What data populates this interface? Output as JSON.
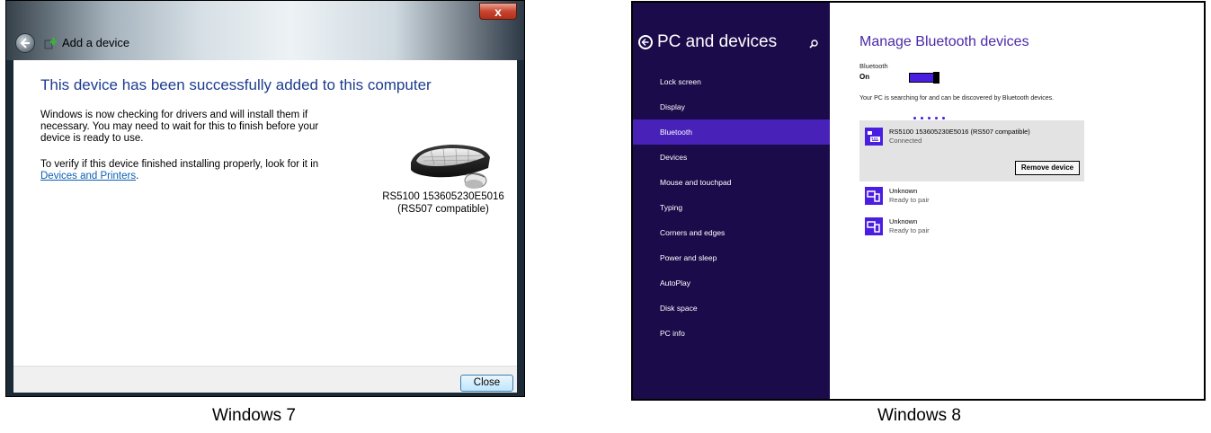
{
  "win7": {
    "close_glyph": "x",
    "wizard_title": "Add a device",
    "heading": "This device has been successfully added to this computer",
    "paragraph1": "Windows is now checking for drivers and will install them if necessary. You may need to wait for this to finish before your device is ready to use.",
    "paragraph2_prefix": "To verify if this device finished installing properly, look for it in ",
    "paragraph2_link": "Devices and Printers",
    "paragraph2_suffix": ".",
    "device_name_line1": "RS5100 153605230E5016",
    "device_name_line2": "(RS507 compatible)",
    "close_button": "Close",
    "caption": "Windows 7"
  },
  "win8": {
    "sidebar_title": "PC and devices",
    "nav_items": [
      {
        "label": "Lock screen"
      },
      {
        "label": "Display"
      },
      {
        "label": "Bluetooth"
      },
      {
        "label": "Devices"
      },
      {
        "label": "Mouse and touchpad"
      },
      {
        "label": "Typing"
      },
      {
        "label": "Corners and edges"
      },
      {
        "label": "Power and sleep"
      },
      {
        "label": "AutoPlay"
      },
      {
        "label": "Disk space"
      },
      {
        "label": "PC info"
      }
    ],
    "active_nav": "Bluetooth",
    "page_title": "Manage Bluetooth devices",
    "bluetooth_label": "Bluetooth",
    "bluetooth_state": "On",
    "searching_text": "Your PC is searching for and can be discovered by Bluetooth devices.",
    "devices": [
      {
        "name": "RS5100 153605230E5016  (RS507 compatible)",
        "status": "Connected",
        "icon": "keyboard-icon"
      },
      {
        "name": "Unknown",
        "status": "Ready to pair",
        "icon": "phone-icon"
      },
      {
        "name": "Unknown",
        "status": "Ready to pair",
        "icon": "phone-icon"
      }
    ],
    "remove_button": "Remove device",
    "caption": "Windows 8"
  },
  "colors": {
    "win8_sidebar": "#1b0b4b",
    "win8_accent": "#4a1ee0",
    "win8_active_nav": "#4821b9",
    "win7_heading": "#1e3d8f",
    "win7_link": "#0b5eb5"
  }
}
